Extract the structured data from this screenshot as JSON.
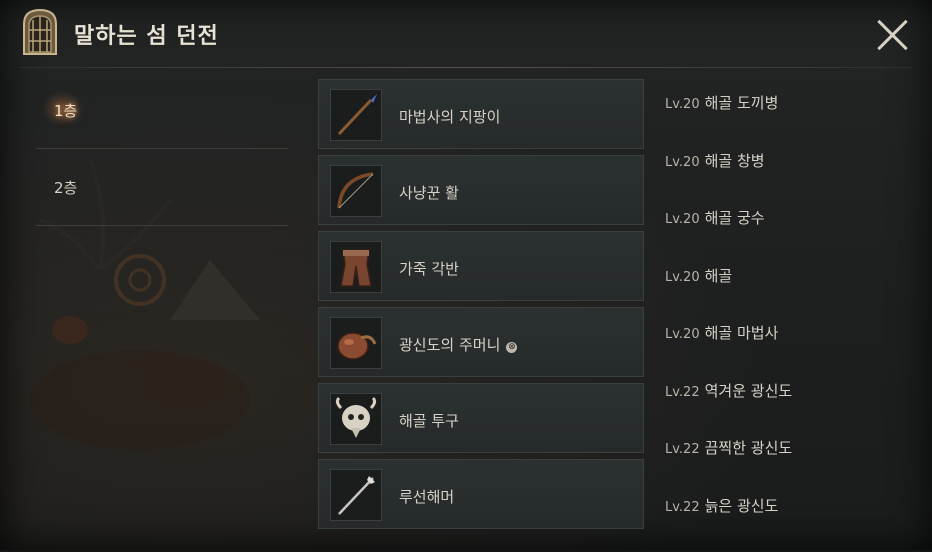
{
  "header": {
    "title": "말하는 섬 던전",
    "close_icon": "close-icon",
    "dungeon_icon": "dungeon-gate-icon"
  },
  "floors": [
    {
      "label": "1층",
      "active": true
    },
    {
      "label": "2층",
      "active": false
    }
  ],
  "items": [
    {
      "name": "마법사의 지팡이",
      "icon": "staff-icon",
      "info": false
    },
    {
      "name": "사냥꾼 활",
      "icon": "bow-icon",
      "info": false
    },
    {
      "name": "가죽 각반",
      "icon": "leather-greaves-icon",
      "info": false
    },
    {
      "name": "광신도의 주머니",
      "icon": "pouch-icon",
      "info": true,
      "info_glyph": "⊗"
    },
    {
      "name": "해골 투구",
      "icon": "skull-helmet-icon",
      "info": false
    },
    {
      "name": "루선해머",
      "icon": "hammer-icon",
      "info": false
    }
  ],
  "monsters": [
    {
      "level": "Lv.20",
      "name": "해골 도끼병"
    },
    {
      "level": "Lv.20",
      "name": "해골 창병"
    },
    {
      "level": "Lv.20",
      "name": "해골 궁수"
    },
    {
      "level": "Lv.20",
      "name": "해골"
    },
    {
      "level": "Lv.20",
      "name": "해골 마법사"
    },
    {
      "level": "Lv.22",
      "name": "역겨운 광신도"
    },
    {
      "level": "Lv.22",
      "name": "끔찍한 광신도"
    },
    {
      "level": "Lv.22",
      "name": "늙은 광신도"
    }
  ],
  "colors": {
    "accent": "#f2ddc0",
    "panel": "#1f2121",
    "item_bg": "#2b3030"
  }
}
